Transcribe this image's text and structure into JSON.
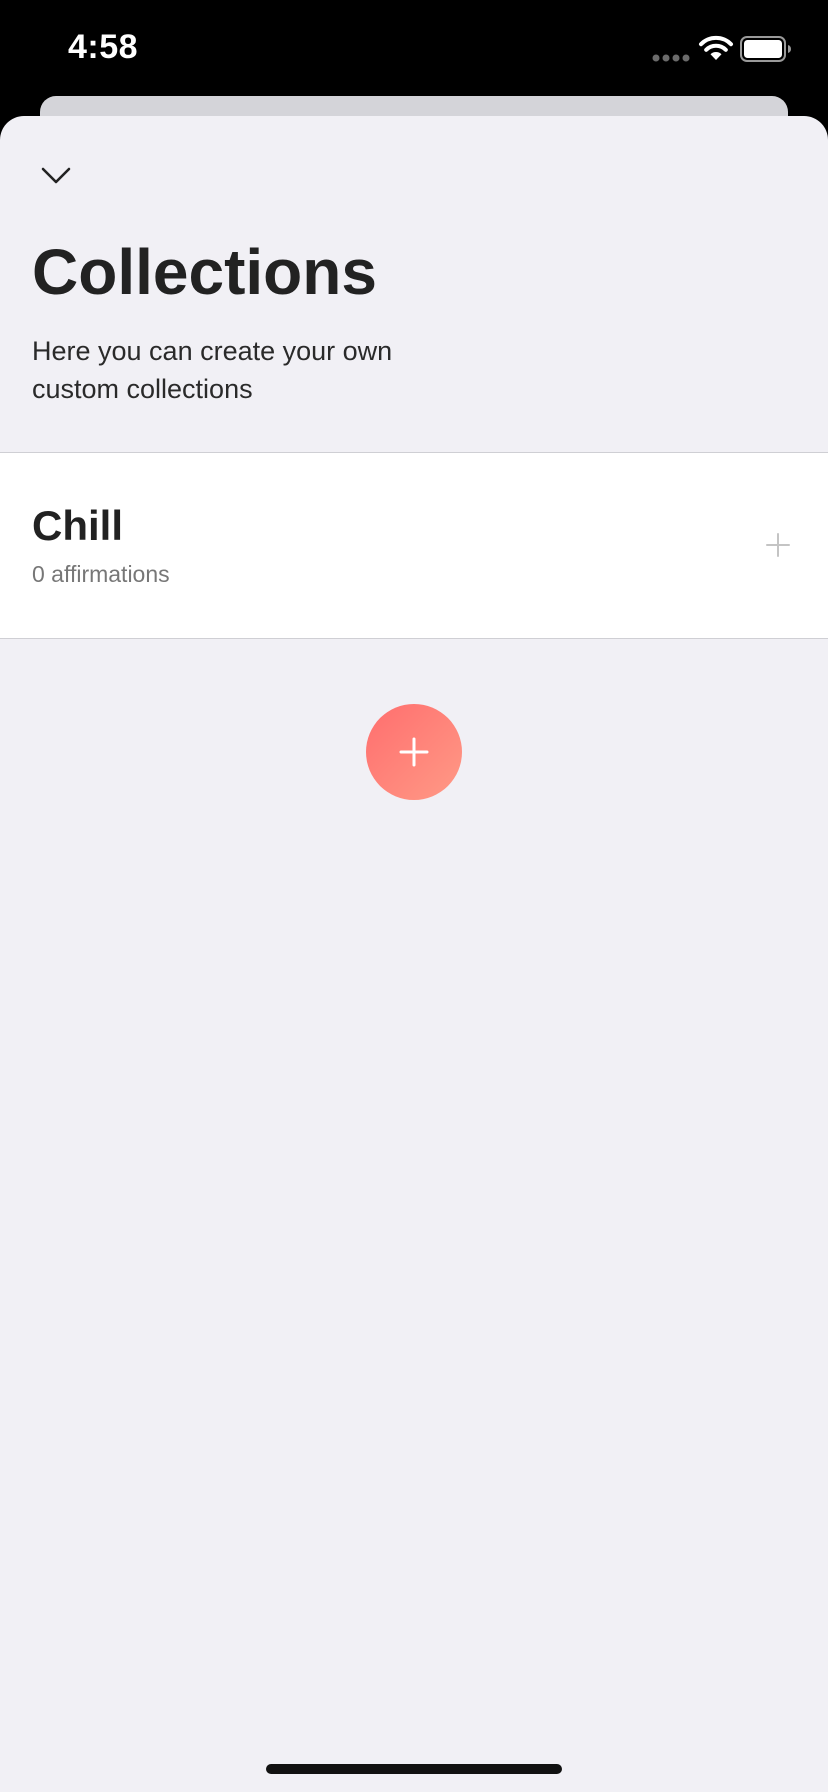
{
  "status_bar": {
    "time": "4:58"
  },
  "header": {
    "title": "Collections",
    "subtitle": "Here you can create your own custom collections"
  },
  "collections": [
    {
      "name": "Chill",
      "count_label": "0 affirmations"
    }
  ],
  "icons": {
    "close": "chevron-down-icon",
    "row_add": "plus-icon",
    "fab": "plus-icon"
  },
  "colors": {
    "accent": "#ff7f7a",
    "sheet_background": "#f1f0f5",
    "row_background": "#ffffff"
  }
}
